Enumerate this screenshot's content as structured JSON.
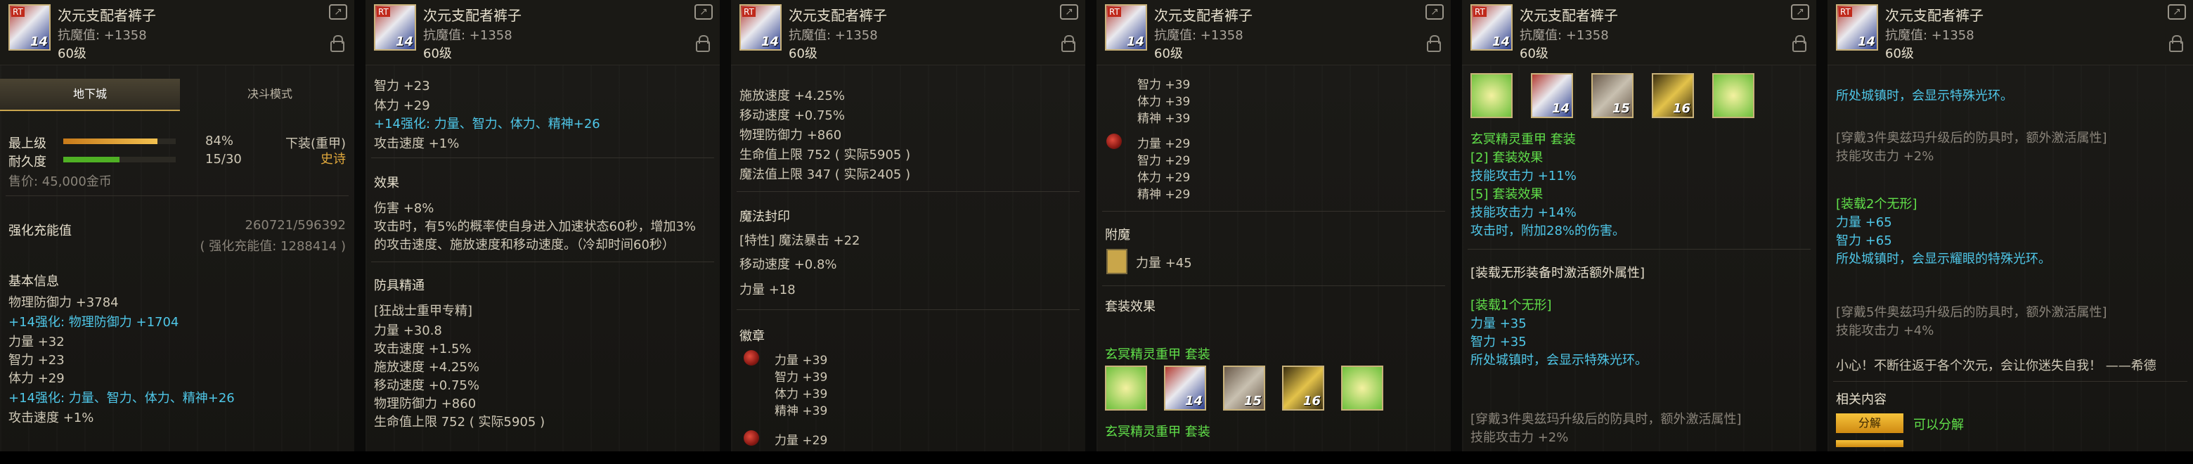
{
  "item": {
    "name": "次元支配者裤子",
    "resist": "抗魔值: +1358",
    "level": "60级",
    "icon_level": "14",
    "icon_tag": "RT"
  },
  "p1": {
    "tabs": [
      "地下城",
      "决斗模式"
    ],
    "grade_label": "最上级",
    "grade_pct": "84%",
    "grade_value": 0.84,
    "durability_label": "耐久度",
    "durability_val": "15/30",
    "durability_value": 0.5,
    "trade": "下装(重甲)",
    "rarity": "史诗",
    "price": "售价: 45,000金币",
    "charge_label": "强化充能值",
    "charge_val": "260721/596392",
    "charge_sub": "( 强化充能值: 1288414 )",
    "basic_title": "基本信息",
    "lines": [
      "物理防御力 +3784",
      "+14强化: 物理防御力 +1704",
      "力量 +32",
      "智力 +23",
      "体力 +29",
      "+14强化: 力量、智力、体力、精神+26",
      "攻击速度 +1%"
    ]
  },
  "p2": {
    "top": [
      "智力 +23",
      "体力 +29",
      "+14强化: 力量、智力、体力、精神+26",
      "攻击速度 +1%"
    ],
    "effect_title": "效果",
    "effect": [
      "伤害 +8%",
      "攻击时，有5%的概率使自身进入加速状态60秒，增加3%",
      "的攻击速度、施放速度和移动速度。（冷却时间60秒）"
    ],
    "mastery_title": "防具精通",
    "mastery": [
      "[狂战士重甲专精]",
      "力量 +30.8",
      "攻击速度 +1.5%",
      "施放速度 +4.25%",
      "移动速度 +0.75%",
      "物理防御力 +860",
      "生命值上限 752 ( 实际5905 )"
    ]
  },
  "p3": {
    "top": [
      "施放速度 +4.25%",
      "移动速度 +0.75%",
      "物理防御力 +860",
      "生命值上限 752 ( 实际5905 )",
      "魔法值上限 347 ( 实际2405 )"
    ],
    "seal_title": "魔法封印",
    "seal": [
      "[特性] 魔法暴击 +22",
      "移动速度 +0.8%",
      "力量 +18"
    ],
    "emblem_title": "徽章",
    "emblem1": [
      "力量 +39",
      "智力 +39",
      "体力 +39",
      "精神 +39"
    ],
    "emblem2": [
      "力量 +29"
    ]
  },
  "p4": {
    "top": [
      "智力 +39",
      "体力 +39",
      "精神 +39"
    ],
    "gem": [
      "力量 +29",
      "智力 +29",
      "体力 +29",
      "精神 +29"
    ],
    "enchant_title": "附魔",
    "enchant": "力量 +45",
    "set_title": "套装效果",
    "set_name": "玄冥精灵重甲 套装",
    "set_name2": "玄冥精灵重甲 套装",
    "icons": [
      "",
      "14",
      "15",
      "16",
      ""
    ]
  },
  "p5": {
    "icons": [
      "",
      "14",
      "15",
      "16",
      ""
    ],
    "set_name": "玄冥精灵重甲 套装",
    "lines": [
      "[2] 套装效果",
      "技能攻击力 +11%",
      "[5] 套装效果",
      "技能攻击力 +14%",
      "攻击时，附加28%的伤害。"
    ],
    "extra_title": "[装载无形装备时激活额外属性]",
    "extra_sub": "[装载1个无形]",
    "extra": [
      "力量 +35",
      "智力 +35",
      "所处城镇时，会显示特殊光环。"
    ],
    "tail": [
      "[穿戴3件奥兹玛升级后的防具时，额外激活属性]",
      "技能攻击力 +2%"
    ]
  },
  "p6": {
    "top": "所处城镇时，会显示特殊光环。",
    "a": [
      "[穿戴3件奥兹玛升级后的防具时，额外激活属性]",
      "技能攻击力 +2%"
    ],
    "b_title": "[装载2个无形]",
    "b": [
      "力量 +65",
      "智力 +65",
      "所处城镇时，会显示耀眼的特殊光环。"
    ],
    "c": [
      "[穿戴5件奥兹玛升级后的防具时，额外激活属性]",
      "技能攻击力 +4%"
    ],
    "quote": "小心！不断往返于各个次元，会让你迷失自我！ ——希德",
    "rel_title": "相关内容",
    "btn1": "分解",
    "btn1_text": "可以分解",
    "btn2": "..."
  }
}
